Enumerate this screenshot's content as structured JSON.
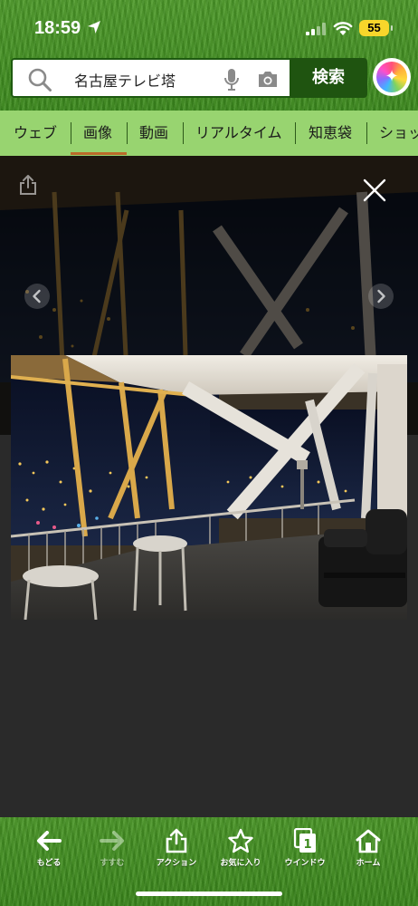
{
  "status_bar": {
    "time": "18:59",
    "battery": "55",
    "battery_color": "#f7d62b"
  },
  "search": {
    "query": "名古屋テレビ塔",
    "button_label": "検索",
    "button_color": "#1f5410"
  },
  "tabs": [
    {
      "label": "ウェブ",
      "active": false
    },
    {
      "label": "画像",
      "active": true
    },
    {
      "label": "動画",
      "active": false
    },
    {
      "label": "リアルタイム",
      "active": false
    },
    {
      "label": "知恵袋",
      "active": false
    },
    {
      "label": "ショッ",
      "active": false
    }
  ],
  "tabs_color": "#98d470",
  "active_tab_indicator_color": "#ba6a2a",
  "viewer": {
    "background_color": "#2a2a2a",
    "icons": [
      "share-icon",
      "close-icon",
      "chevron-left-icon",
      "chevron-right-icon"
    ]
  },
  "toolbar": {
    "items": [
      {
        "label": "もどる",
        "icon": "arrow-left-icon",
        "enabled": true
      },
      {
        "label": "すすむ",
        "icon": "arrow-right-icon",
        "enabled": false
      },
      {
        "label": "アクション",
        "icon": "share-icon",
        "enabled": true
      },
      {
        "label": "お気に入り",
        "icon": "star-icon",
        "enabled": true
      },
      {
        "label": "ウインドウ",
        "icon": "windows-icon",
        "enabled": true,
        "badge": "1"
      },
      {
        "label": "ホーム",
        "icon": "home-icon",
        "enabled": true
      }
    ]
  }
}
